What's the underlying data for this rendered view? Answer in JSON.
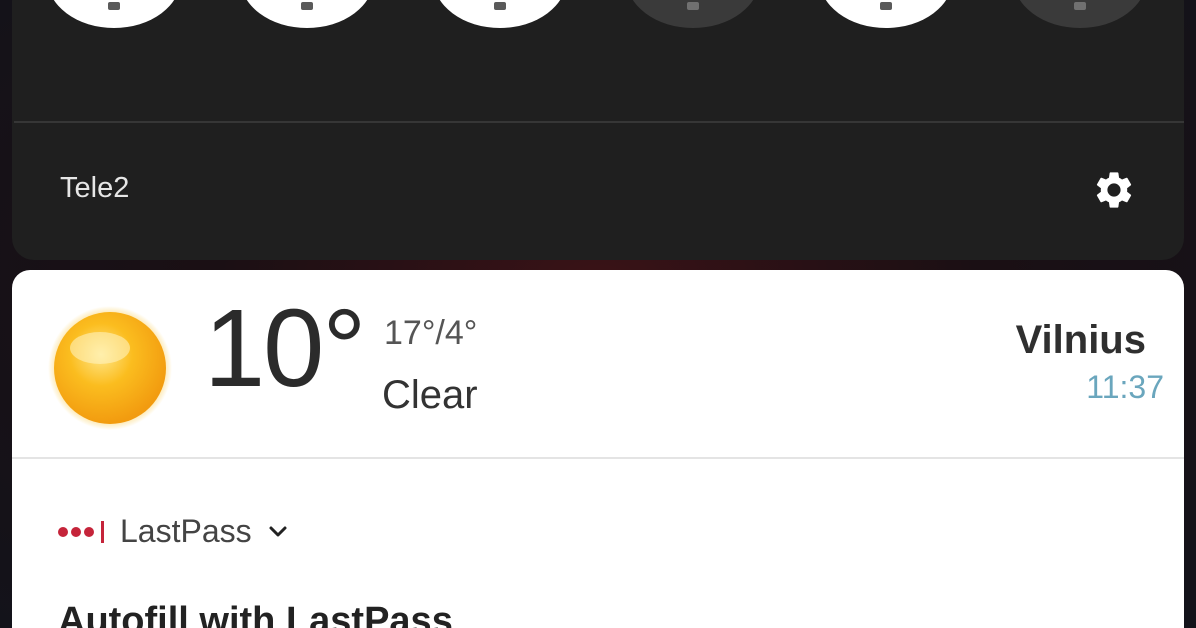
{
  "quick_settings": {
    "tiles": [
      {
        "state": "on",
        "icon": "wifi-icon"
      },
      {
        "state": "on",
        "icon": "mobile-data-icon"
      },
      {
        "state": "on",
        "icon": "bluetooth-icon"
      },
      {
        "state": "off",
        "icon": "flashlight-icon"
      },
      {
        "state": "on",
        "icon": "auto-rotate-icon"
      },
      {
        "state": "off",
        "icon": "battery-saver-icon"
      }
    ],
    "carrier": "Tele2",
    "settings_icon": "gear-icon"
  },
  "weather": {
    "icon": "sun-icon",
    "temperature": "10°",
    "high_low": "17°/4°",
    "condition": "Clear",
    "city": "Vilnius",
    "time": "11:37"
  },
  "notification": {
    "app_name": "LastPass",
    "app_icon": "lastpass-logo-icon",
    "expand_icon": "chevron-down-icon",
    "title": "Autofill with LastPass",
    "brand_color": "#c5243a"
  },
  "colors": {
    "panel_bg": "#1f1f1f",
    "accent_time": "#6aa6bd"
  }
}
